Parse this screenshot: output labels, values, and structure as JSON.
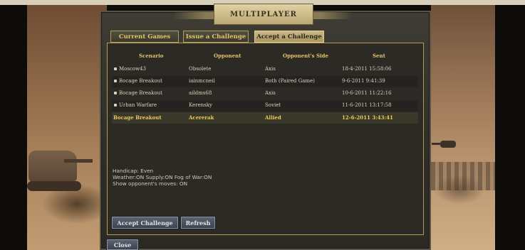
{
  "window": {
    "title": "MULTIPLAYER"
  },
  "tabs": [
    {
      "label": "Current Games",
      "active": false
    },
    {
      "label": "Issue a Challenge",
      "active": false
    },
    {
      "label": "Accept a Challenge",
      "active": true
    }
  ],
  "table": {
    "headers": [
      "Scenario",
      "Opponent",
      "Opponent's Side",
      "Sent"
    ],
    "rows": [
      {
        "scenario": "Moscow43",
        "opponent": "Obsolete",
        "side": "Axis",
        "sent": "18-4-2011 15:58:06",
        "bullet": true,
        "selected": false
      },
      {
        "scenario": "Bocage Breakout",
        "opponent": "iainmcneil",
        "side": "Both (Paired Game)",
        "sent": "9-6-2011 9:41:39",
        "bullet": true,
        "selected": false
      },
      {
        "scenario": "Bocage Breakout",
        "opponent": "aildms68",
        "side": "Axis",
        "sent": "10-6-2011 11:22:16",
        "bullet": true,
        "selected": false
      },
      {
        "scenario": "Urban Warfare",
        "opponent": "Kerensky",
        "side": "Soviet",
        "sent": "11-6-2011 13:17:58",
        "bullet": true,
        "selected": false
      },
      {
        "scenario": "Bocage Breakout",
        "opponent": "Acererak",
        "side": "Allied",
        "sent": "12-6-2011 3:43:41",
        "bullet": false,
        "selected": true
      }
    ]
  },
  "details": {
    "handicap": "Handicap: Even",
    "settings": "Weather:ON  Supply:ON  Fog of War:ON",
    "show_moves": "Show opponent's moves: ON"
  },
  "buttons": {
    "accept": "Accept Challenge",
    "refresh": "Refresh",
    "close": "Close"
  }
}
